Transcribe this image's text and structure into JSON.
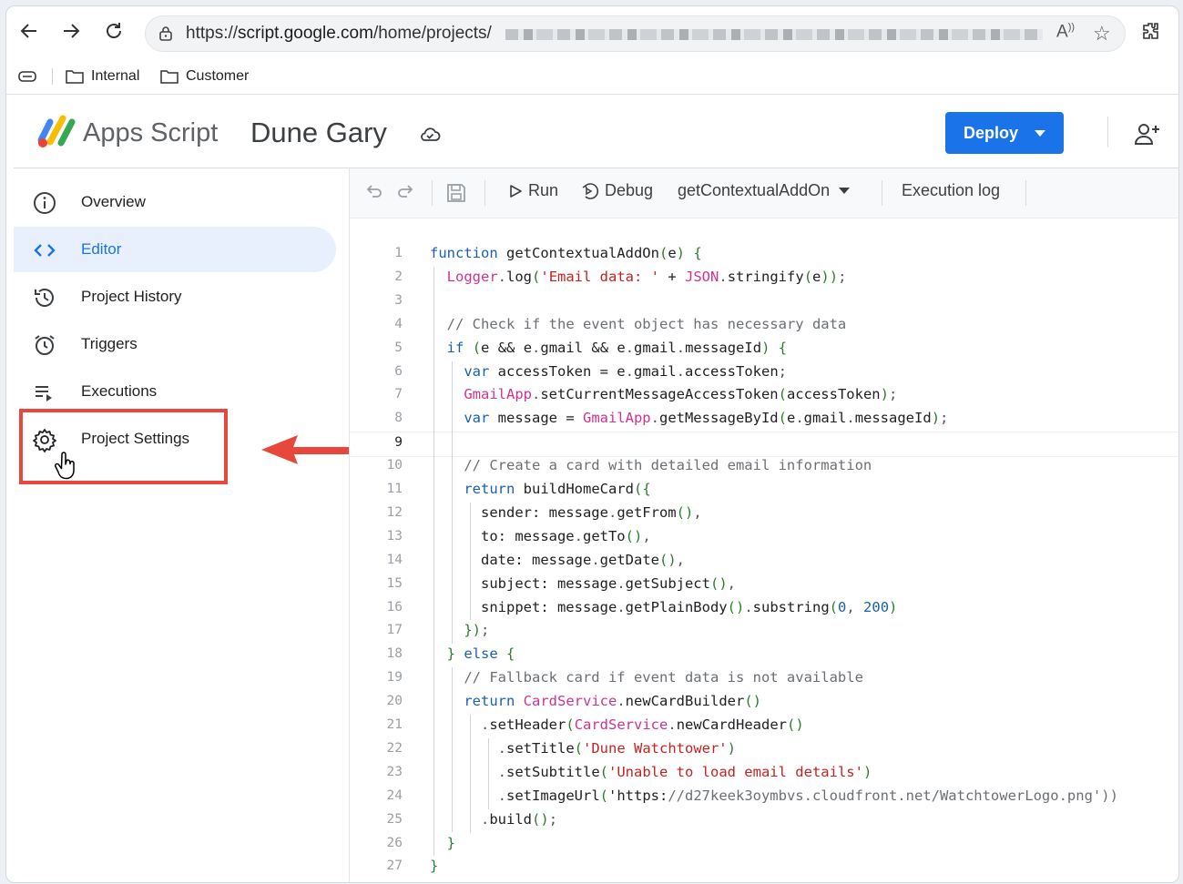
{
  "browser": {
    "url_prefix": "https://",
    "url_host": "script.google.com",
    "url_path": "/home/projects/",
    "bookmarks": [
      {
        "label": "Internal"
      },
      {
        "label": "Customer"
      }
    ]
  },
  "header": {
    "app_name": "Apps Script",
    "project_name": "Dune Gary",
    "deploy_label": "Deploy"
  },
  "sidebar": {
    "items": [
      {
        "label": "Overview",
        "icon": "info-icon"
      },
      {
        "label": "Editor",
        "icon": "code-icon",
        "active": true
      },
      {
        "label": "Project History",
        "icon": "history-icon"
      },
      {
        "label": "Triggers",
        "icon": "alarm-icon"
      },
      {
        "label": "Executions",
        "icon": "executions-icon"
      },
      {
        "label": "Project Settings",
        "icon": "gear-icon",
        "highlighted": true
      }
    ]
  },
  "toolbar": {
    "run_label": "Run",
    "debug_label": "Debug",
    "function_selected": "getContextualAddOn",
    "execution_log_label": "Execution log"
  },
  "colors": {
    "accent": "#1a73e8",
    "highlight": "#e8473c",
    "keyword": "#1a5fb4",
    "string": "#c5221f",
    "object": "#d0338f"
  },
  "code": {
    "current_line": 9,
    "lines": [
      "function getContextualAddOn(e) {",
      "  Logger.log('Email data: ' + JSON.stringify(e));",
      "",
      "  // Check if the event object has necessary data",
      "  if (e && e.gmail && e.gmail.messageId) {",
      "    var accessToken = e.gmail.accessToken;",
      "    GmailApp.setCurrentMessageAccessToken(accessToken);",
      "    var message = GmailApp.getMessageById(e.gmail.messageId);",
      "",
      "    // Create a card with detailed email information",
      "    return buildHomeCard({",
      "      sender: message.getFrom(),",
      "      to: message.getTo(),",
      "      date: message.getDate(),",
      "      subject: message.getSubject(),",
      "      snippet: message.getPlainBody().substring(0, 200)",
      "    });",
      "  } else {",
      "    // Fallback card if event data is not available",
      "    return CardService.newCardBuilder()",
      "      .setHeader(CardService.newCardHeader()",
      "        .setTitle('Dune Watchtower')",
      "        .setSubtitle('Unable to load email details')",
      "        .setImageUrl('https://d27keek3oymbvs.cloudfront.net/WatchtowerLogo.png'))",
      "      .build();",
      "  }",
      "}"
    ]
  }
}
